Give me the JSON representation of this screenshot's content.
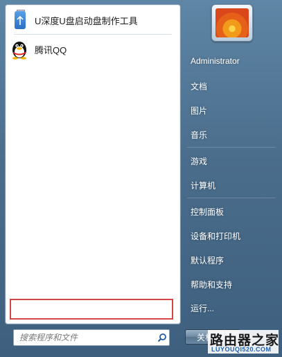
{
  "programs": [
    {
      "label": "U深度U盘启动盘制作工具",
      "icon": "usb-drive-icon"
    },
    {
      "label": "腾讯QQ",
      "icon": "qq-penguin-icon"
    }
  ],
  "search": {
    "placeholder": "搜索程序和文件",
    "icon": "magnifier-icon"
  },
  "user": {
    "name": "Administrator",
    "avatar_icon": "flower-avatar-icon"
  },
  "right_menu": [
    "文档",
    "图片",
    "音乐",
    "游戏",
    "计算机",
    "控制面板",
    "设备和打印机",
    "默认程序",
    "帮助和支持",
    "运行..."
  ],
  "shutdown": {
    "label": "关机"
  },
  "watermark": {
    "main": "路由器之家",
    "sub": "LUYOUQI520.COM"
  },
  "colors": {
    "highlight": "#d64545",
    "menu_bg": "#4a6d8b"
  }
}
